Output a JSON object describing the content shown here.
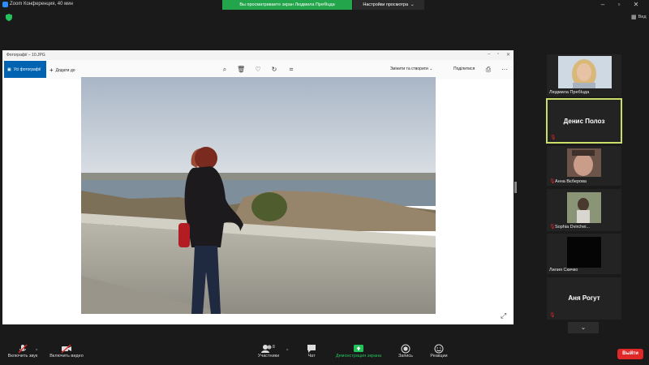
{
  "titlebar": {
    "title": "Zoom Конференция, 40 мин"
  },
  "share_banner": {
    "text": "Вы просматриваете экран Людмила Пребluда"
  },
  "view_settings": {
    "label": "Настройки просмотра",
    "caret": "⌄"
  },
  "view_button": {
    "label": "Вид"
  },
  "photos_app": {
    "title": "Фотографії – 10.JPG",
    "all_photos": "Усі фотографії",
    "add_to": "Додати до",
    "edit_create": "Змінити та створити ⌄",
    "share": "Поділитися",
    "more": "···"
  },
  "participants": [
    {
      "name": "Людмила Пребluда",
      "type": "video",
      "muted": false
    },
    {
      "name": "Денис Полоз",
      "type": "name",
      "muted": true,
      "active_speaker": true
    },
    {
      "name": "Анна Вєберова",
      "type": "video",
      "muted": true
    },
    {
      "name": "Sophia Dvirchei...",
      "type": "video",
      "muted": true
    },
    {
      "name": "Лилия Скичко",
      "type": "dark",
      "muted": true
    },
    {
      "name": "Аня Рогут",
      "type": "name",
      "muted": true
    }
  ],
  "bottombar": {
    "mute": "Включить звук",
    "video": "Включить видео",
    "participants": "Участники",
    "participants_count": "8",
    "chat": "Чат",
    "share_screen": "Демонстрация экрана",
    "record": "Запись",
    "reactions": "Реакции",
    "leave": "Выйти"
  },
  "colors": {
    "share_green": "#23a64b",
    "accent_blue": "#0063b1",
    "leave_red": "#e02828",
    "speaker_border": "#c9df6a"
  }
}
